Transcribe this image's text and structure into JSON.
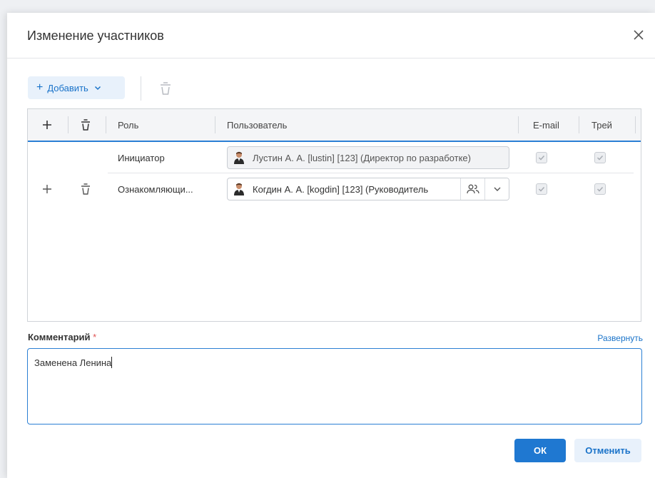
{
  "dialog": {
    "title": "Изменение участников"
  },
  "toolbar": {
    "add_label": "Добавить"
  },
  "grid": {
    "columns": {
      "role": "Роль",
      "user": "Пользователь",
      "email": "E-mail",
      "tray": "Трей"
    },
    "rows": [
      {
        "role": "Инициатор",
        "user": "Лустин А. А. [lustin] [123] (Директор по разработке)",
        "email": true,
        "tray": true
      },
      {
        "role": "Ознакомляющи...",
        "user": "Когдин А. А. [kogdin] [123] (Руководитель",
        "email": true,
        "tray": true
      }
    ]
  },
  "comment": {
    "label": "Комментарий",
    "required_mark": "*",
    "expand_label": "Развернуть",
    "value": "Заменена Ленина"
  },
  "buttons": {
    "ok": "ОК",
    "cancel": "Отменить"
  },
  "colors": {
    "accent": "#1f78d1",
    "accent_light": "#e8f1fb",
    "required": "#e05353"
  },
  "icons": [
    "close-icon",
    "plus-icon",
    "chevron-down-icon",
    "trash-icon",
    "avatar-icon",
    "people-icon",
    "checkbox-icon"
  ]
}
